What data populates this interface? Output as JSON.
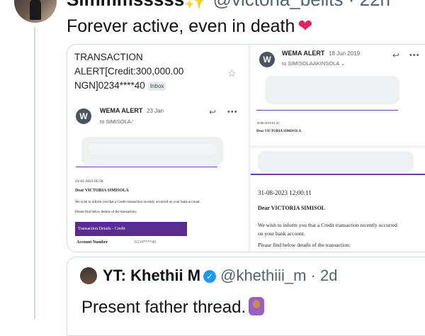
{
  "tweet": {
    "author_name": "Simmmsssss✨",
    "author_handle": "@victoria_bellts · 22h",
    "text": "Forever active, even in death",
    "heart": "❤"
  },
  "email_left": {
    "subject_line1": "TRANSACTION",
    "subject_line2": "ALERT[Credit:300,000.00",
    "subject_line3": "NGN]0234****40",
    "badge": "Inbox",
    "sender_initial": "W",
    "sender_name": "WEMA ALERT",
    "date": "23 Jan",
    "to": "to SIMISOLA ⁄",
    "stamp": "23-01-2023 05:58",
    "greeting": "Dear VICTORIA SIMISOLA",
    "body": "We wish to inform you that a Credit transaction recently occurred on your bank account.",
    "details": "Please find below details of the transaction:",
    "table_title": "Transaction Details - Credit",
    "account_label": "Account Number",
    "account_value": "0234****40"
  },
  "email_top_right": {
    "sender_initial": "W",
    "sender_name": "WEMA ALERT",
    "date": "18 Jun 2019",
    "to": "to SIMISOLAAKINSOLA ⌄",
    "stamp": "18-06-2019 01:25",
    "greeting": "Dear VICTORIA SIMISOLA"
  },
  "email_bottom_right": {
    "stamp": "31-08-2023 12:00:11",
    "greeting": "Dear VICTORIA SIMISOL",
    "body_line1": "We wish to inform you that a Credit transaction recently occurred",
    "body_line2": "on your bank account.",
    "details": "Please find below details of the transaction:"
  },
  "icons": {
    "reply": "↩",
    "more": "•••",
    "star": "☆"
  },
  "quote": {
    "author_name": "YT: Khethii M",
    "verified": "✓",
    "author_handle": "@khethiii_m · 2d",
    "text": "Present father thread."
  }
}
